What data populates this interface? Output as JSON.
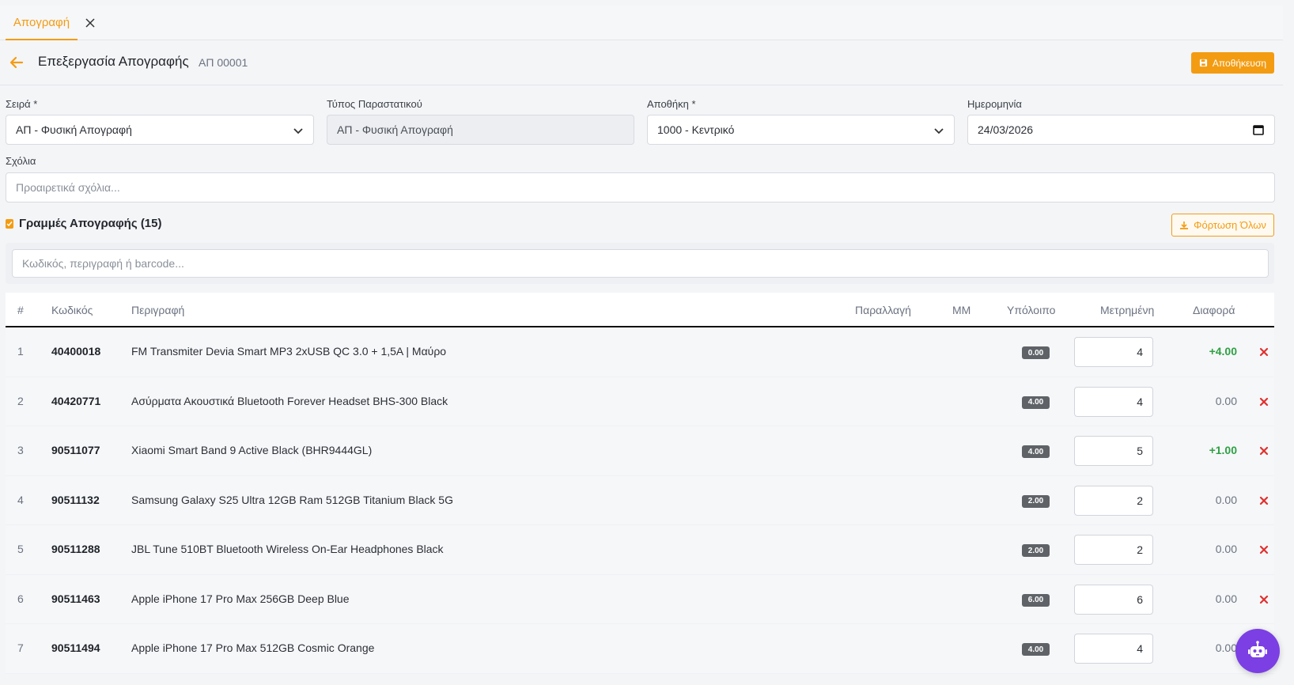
{
  "tabs": [
    {
      "label": "Απογραφή",
      "active": true
    }
  ],
  "header": {
    "title": "Επεξεργασία Απογραφής",
    "doc_number": "ΑΠ 00001",
    "save_label": "Αποθήκευση"
  },
  "form": {
    "series": {
      "label": "Σειρά *",
      "value": "ΑΠ - Φυσική Απογραφή"
    },
    "doc_type": {
      "label": "Τύπος Παραστατικού",
      "value": "ΑΠ - Φυσική Απογραφή"
    },
    "warehouse": {
      "label": "Αποθήκη *",
      "value": "1000 - Κεντρικό"
    },
    "date": {
      "label": "Ημερομηνία",
      "value": "24/03/2026"
    },
    "comments": {
      "label": "Σχόλια",
      "placeholder": "Προαιρετικά σχόλια..."
    }
  },
  "lines": {
    "title": "Γραμμές Απογραφής (15)",
    "load_all_label": "Φόρτωση Όλων",
    "search_placeholder": "Κωδικός, περιγραφή ή barcode...",
    "columns": [
      "#",
      "Κωδικός",
      "Περιγραφή",
      "Παραλλαγή",
      "ΜΜ",
      "Υπόλοιπο",
      "Μετρημένη",
      "Διαφορά"
    ],
    "rows": [
      {
        "idx": "1",
        "code": "40400018",
        "desc": "FM Transmiter Devia Smart MP3 2xUSB QC 3.0 + 1,5A | Μαύρο",
        "balance": "0.00",
        "counted": "4",
        "diff": "+4.00",
        "diff_type": "pos"
      },
      {
        "idx": "2",
        "code": "40420771",
        "desc": "Ασύρματα Ακουστικά Bluetooth Forever Headset BHS-300 Black",
        "balance": "4.00",
        "counted": "4",
        "diff": "0.00",
        "diff_type": "zero"
      },
      {
        "idx": "3",
        "code": "90511077",
        "desc": "Xiaomi Smart Band 9 Active Black (BHR9444GL)",
        "balance": "4.00",
        "counted": "5",
        "diff": "+1.00",
        "diff_type": "pos"
      },
      {
        "idx": "4",
        "code": "90511132",
        "desc": "Samsung Galaxy S25 Ultra 12GB Ram 512GB Titanium Black 5G",
        "balance": "2.00",
        "counted": "2",
        "diff": "0.00",
        "diff_type": "zero"
      },
      {
        "idx": "5",
        "code": "90511288",
        "desc": "JBL Tune 510BT Bluetooth Wireless On-Ear Headphones Black",
        "balance": "2.00",
        "counted": "2",
        "diff": "0.00",
        "diff_type": "zero"
      },
      {
        "idx": "6",
        "code": "90511463",
        "desc": "Apple iPhone 17 Pro Max 256GB Deep Blue",
        "balance": "6.00",
        "counted": "6",
        "diff": "0.00",
        "diff_type": "zero"
      },
      {
        "idx": "7",
        "code": "90511494",
        "desc": "Apple iPhone 17 Pro Max 512GB Cosmic Orange",
        "balance": "4.00",
        "counted": "4",
        "diff": "0.00",
        "diff_type": "zero"
      }
    ]
  },
  "colors": {
    "accent": "#f39c12",
    "positive": "#2ea043",
    "delete": "#e0312f",
    "bot": "#7b3fe4"
  },
  "icons": {
    "back": "arrow-left-icon",
    "save": "floppy-icon",
    "download": "download-icon",
    "close": "close-icon",
    "delete": "x-icon",
    "bot": "robot-icon"
  }
}
